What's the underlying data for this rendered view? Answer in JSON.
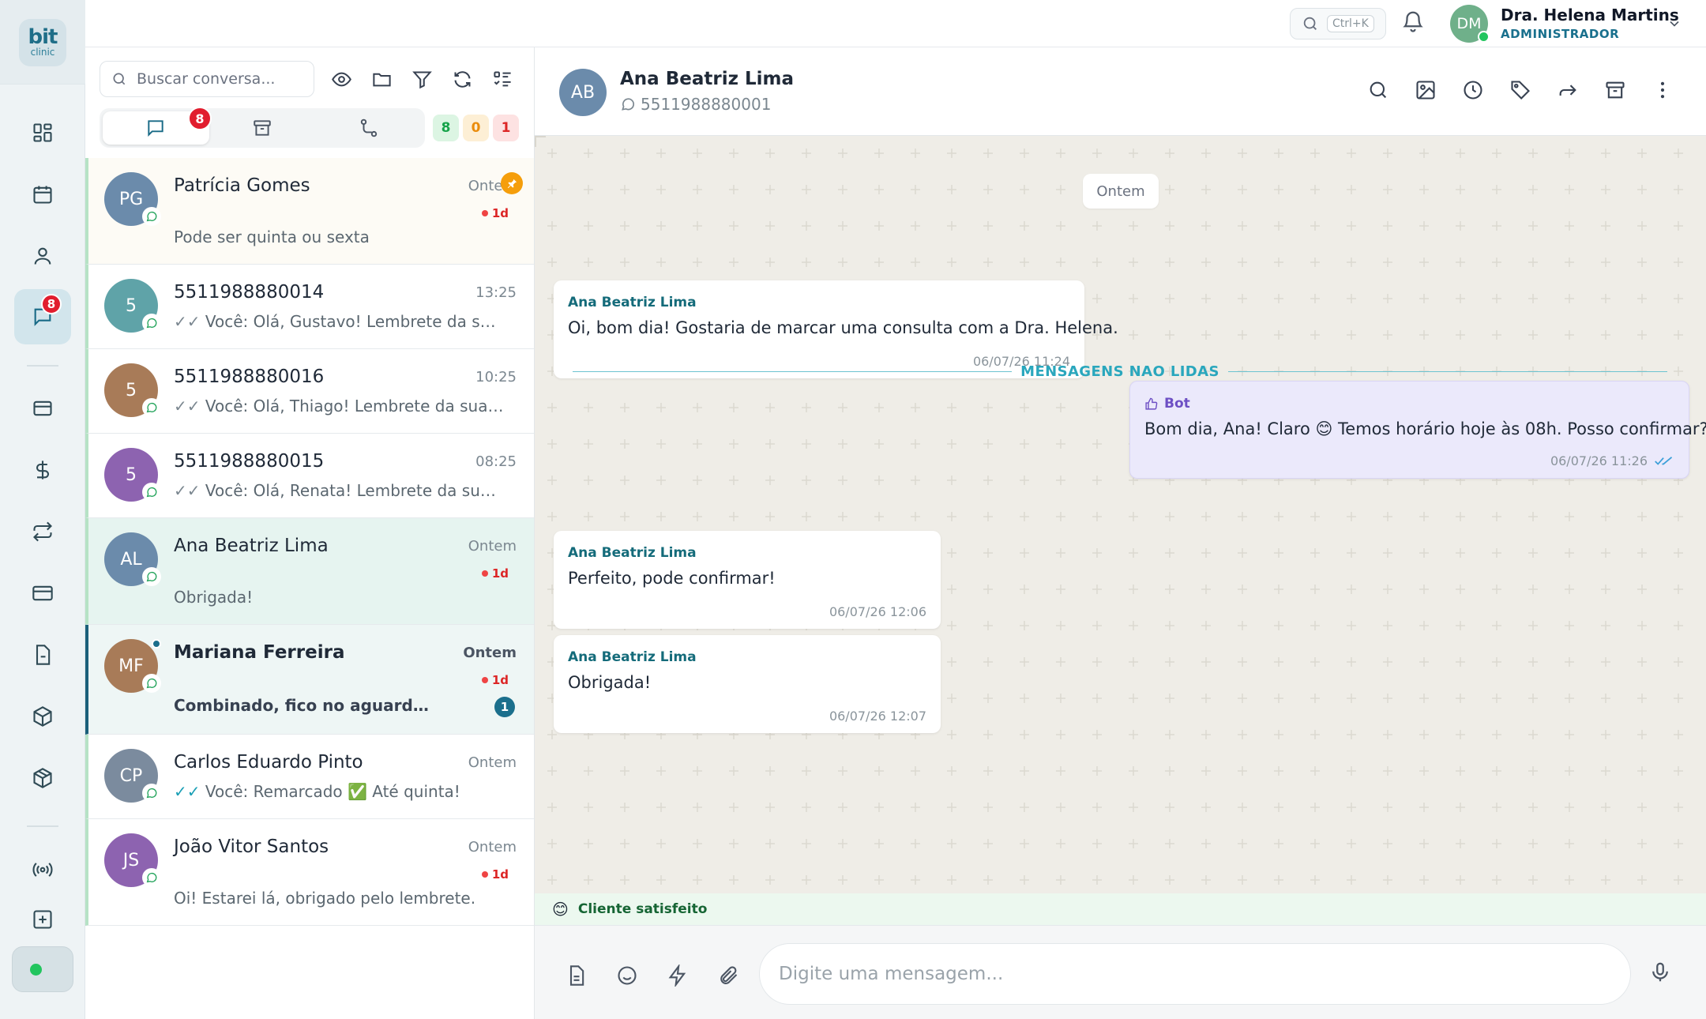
{
  "brand": {
    "logo_top": "bit",
    "logo_bottom": "clinic",
    "color": "#1f6e88"
  },
  "rail": {
    "items": [
      {
        "icon": "dashboard-icon"
      },
      {
        "icon": "calendar-icon"
      },
      {
        "icon": "user-icon"
      },
      {
        "icon": "chat-icon",
        "badge": "8",
        "active": true
      },
      {
        "icon": "card-icon"
      },
      {
        "icon": "dollar-icon"
      },
      {
        "icon": "repeat-icon"
      },
      {
        "icon": "wallet-icon"
      },
      {
        "icon": "document-icon"
      },
      {
        "icon": "box-icon"
      },
      {
        "icon": "package-icon"
      },
      {
        "icon": "broadcast-icon"
      }
    ]
  },
  "topbar": {
    "search_shortcut": "Ctrl+K",
    "user_initials": "DM",
    "user_name": "Dra. Helena Martins",
    "user_role": "ADMINISTRADOR"
  },
  "list": {
    "search_placeholder": "Buscar conversa...",
    "tab_badge": "8",
    "counts": {
      "green": "8",
      "orange": "0",
      "red": "1"
    },
    "conversations": [
      {
        "initials": "PG",
        "name": "Patrícia Gomes",
        "time": "Ontem",
        "age": "1d",
        "preview": "Pode ser quinta ou sexta",
        "color": "#6b8bab",
        "pinned": true
      },
      {
        "initials": "5",
        "name": "5511988880014",
        "time": "13:25",
        "checks": "✓✓",
        "preview": "Você: Olá, Gustavo! Lembrete da sua consulta amanhã",
        "color": "#5fa3a8"
      },
      {
        "initials": "5",
        "name": "5511988880016",
        "time": "10:25",
        "checks": "✓✓",
        "preview": "Você: Olá, Thiago! Lembrete da sua consulta amanhã",
        "color": "#a87b58"
      },
      {
        "initials": "5",
        "name": "5511988880015",
        "time": "08:25",
        "checks": "✓✓",
        "preview": "Você: Olá, Renata! Lembrete da sua consulta amanhã",
        "color": "#8d63b0"
      },
      {
        "initials": "AL",
        "name": "Ana Beatriz Lima",
        "time": "Ontem",
        "age": "1d",
        "preview": "Obrigada!",
        "color": "#6b8bab",
        "selected": true
      },
      {
        "initials": "MF",
        "name": "Mariana Ferreira",
        "time": "Ontem",
        "age": "1d",
        "preview": "Combinado, fico no aguardo 🙏",
        "color": "#a87b58",
        "unread": "1"
      },
      {
        "initials": "CP",
        "name": "Carlos Eduardo Pinto",
        "time": "Ontem",
        "checks": "✓✓",
        "preview": "Você: Remarcado ✅ Até quinta!",
        "color": "#7b8b9e"
      },
      {
        "initials": "JS",
        "name": "João Vitor Santos",
        "time": "Ontem",
        "age": "1d",
        "preview": "Oi! Estarei lá, obrigado pelo lembrete.",
        "color": "#8d63b0"
      }
    ]
  },
  "chat": {
    "initials": "AB",
    "name": "Ana Beatriz Lima",
    "phone": "5511988880001",
    "date_chip": "Ontem",
    "unread_separator": "MENSAGENS NAO LIDAS",
    "messages": [
      {
        "sender": "Ana Beatriz Lima",
        "text": "Oi, bom dia! Gostaria de marcar uma consulta com a Dra. Helena.",
        "time": "06/07/26 11:24"
      },
      {
        "sender": "Bot",
        "text": "Bom dia, Ana! Claro 😊 Temos horário hoje às 08h. Posso confirmar?",
        "time": "06/07/26 11:26"
      },
      {
        "sender": "Ana Beatriz Lima",
        "text": "Perfeito, pode confirmar!",
        "time": "06/07/26 12:06"
      },
      {
        "sender": "Ana Beatriz Lima",
        "text": "Obrigada!",
        "time": "06/07/26 12:07"
      }
    ],
    "sentiment": "Cliente satisfeito",
    "sentiment_emoji": "😊",
    "composer_placeholder": "Digite uma mensagem..."
  },
  "colors": {
    "accent": "#1b6f8c",
    "badge_red": "#e11d2e",
    "online": "#22c55e",
    "bot_bubble": "#ebe9fb"
  }
}
